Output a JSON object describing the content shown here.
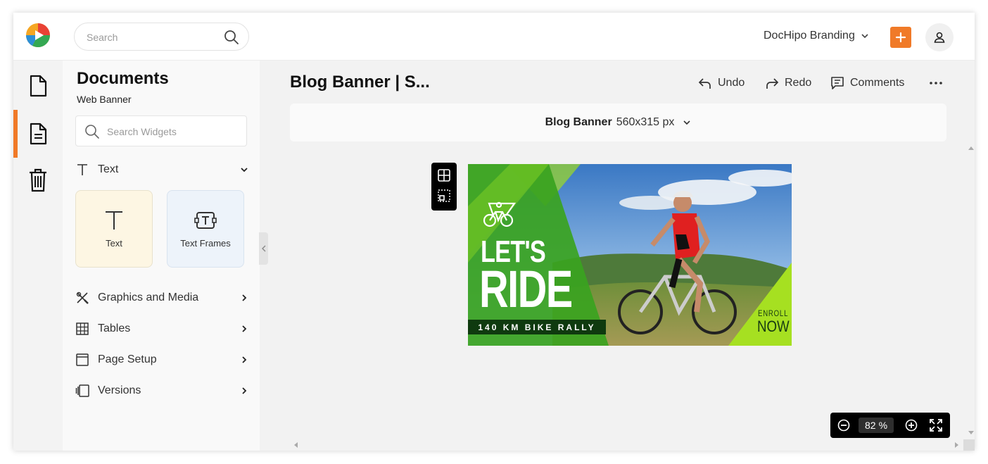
{
  "header": {
    "search_placeholder": "Search",
    "brand_label": "DocHipo Branding",
    "add_icon": "plus-icon",
    "profile_icon": "user-icon",
    "accent_color": "#f07a28"
  },
  "rail": {
    "items": [
      {
        "icon": "document-icon"
      },
      {
        "icon": "page-list-icon",
        "active": true
      },
      {
        "icon": "trash-icon"
      }
    ]
  },
  "panel": {
    "title": "Documents",
    "subtitle": "Web Banner",
    "widget_search_placeholder": "Search Widgets",
    "text_section": {
      "label": "Text",
      "cards": [
        {
          "label": "Text",
          "icon": "text-icon"
        },
        {
          "label": "Text Frames",
          "icon": "text-frame-icon"
        }
      ]
    },
    "sections": [
      {
        "label": "Graphics and Media",
        "icon": "graphics-icon"
      },
      {
        "label": "Tables",
        "icon": "table-icon"
      },
      {
        "label": "Page Setup",
        "icon": "page-setup-icon"
      },
      {
        "label": "Versions",
        "icon": "versions-icon"
      }
    ]
  },
  "editor": {
    "doc_title": "Blog Banner | S...",
    "undo_label": "Undo",
    "redo_label": "Redo",
    "comments_label": "Comments",
    "size_name": "Blog Banner",
    "size_dims": "560x315 px"
  },
  "banner": {
    "line1": "LET'S",
    "line2": "RIDE",
    "strip": "140 KM BIKE RALLY",
    "cta_top": "ENROLL",
    "cta_bottom": "NOW",
    "green_dark": "#2e9e1e",
    "green_light": "#8fd41f"
  },
  "zoom": {
    "value": "82",
    "unit": "%"
  }
}
